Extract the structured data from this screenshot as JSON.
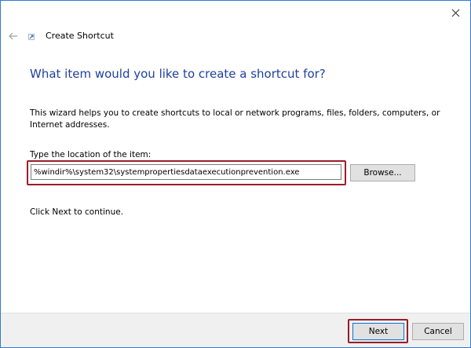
{
  "window": {
    "title": "Create Shortcut",
    "close_symbol": "✕"
  },
  "icons": {
    "back": "back-arrow-icon",
    "close": "close-icon",
    "app": "shortcut-wizard-icon"
  },
  "main": {
    "heading": "What item would you like to create a shortcut for?",
    "description": "This wizard helps you to create shortcuts to local or network programs, files, folders, computers, or Internet addresses.",
    "location_label": "Type the location of the item:",
    "location_value": "%windir%\\system32\\systempropertiesdataexecutionprevention.exe",
    "browse_label": "Browse...",
    "continue_text": "Click Next to continue."
  },
  "footer": {
    "next_label": "Next",
    "cancel_label": "Cancel"
  },
  "colors": {
    "heading": "#1f3fa0",
    "highlight": "#9b1c2a",
    "footer_bg": "#f0f0f0",
    "window_border": "#2b7cd3"
  }
}
